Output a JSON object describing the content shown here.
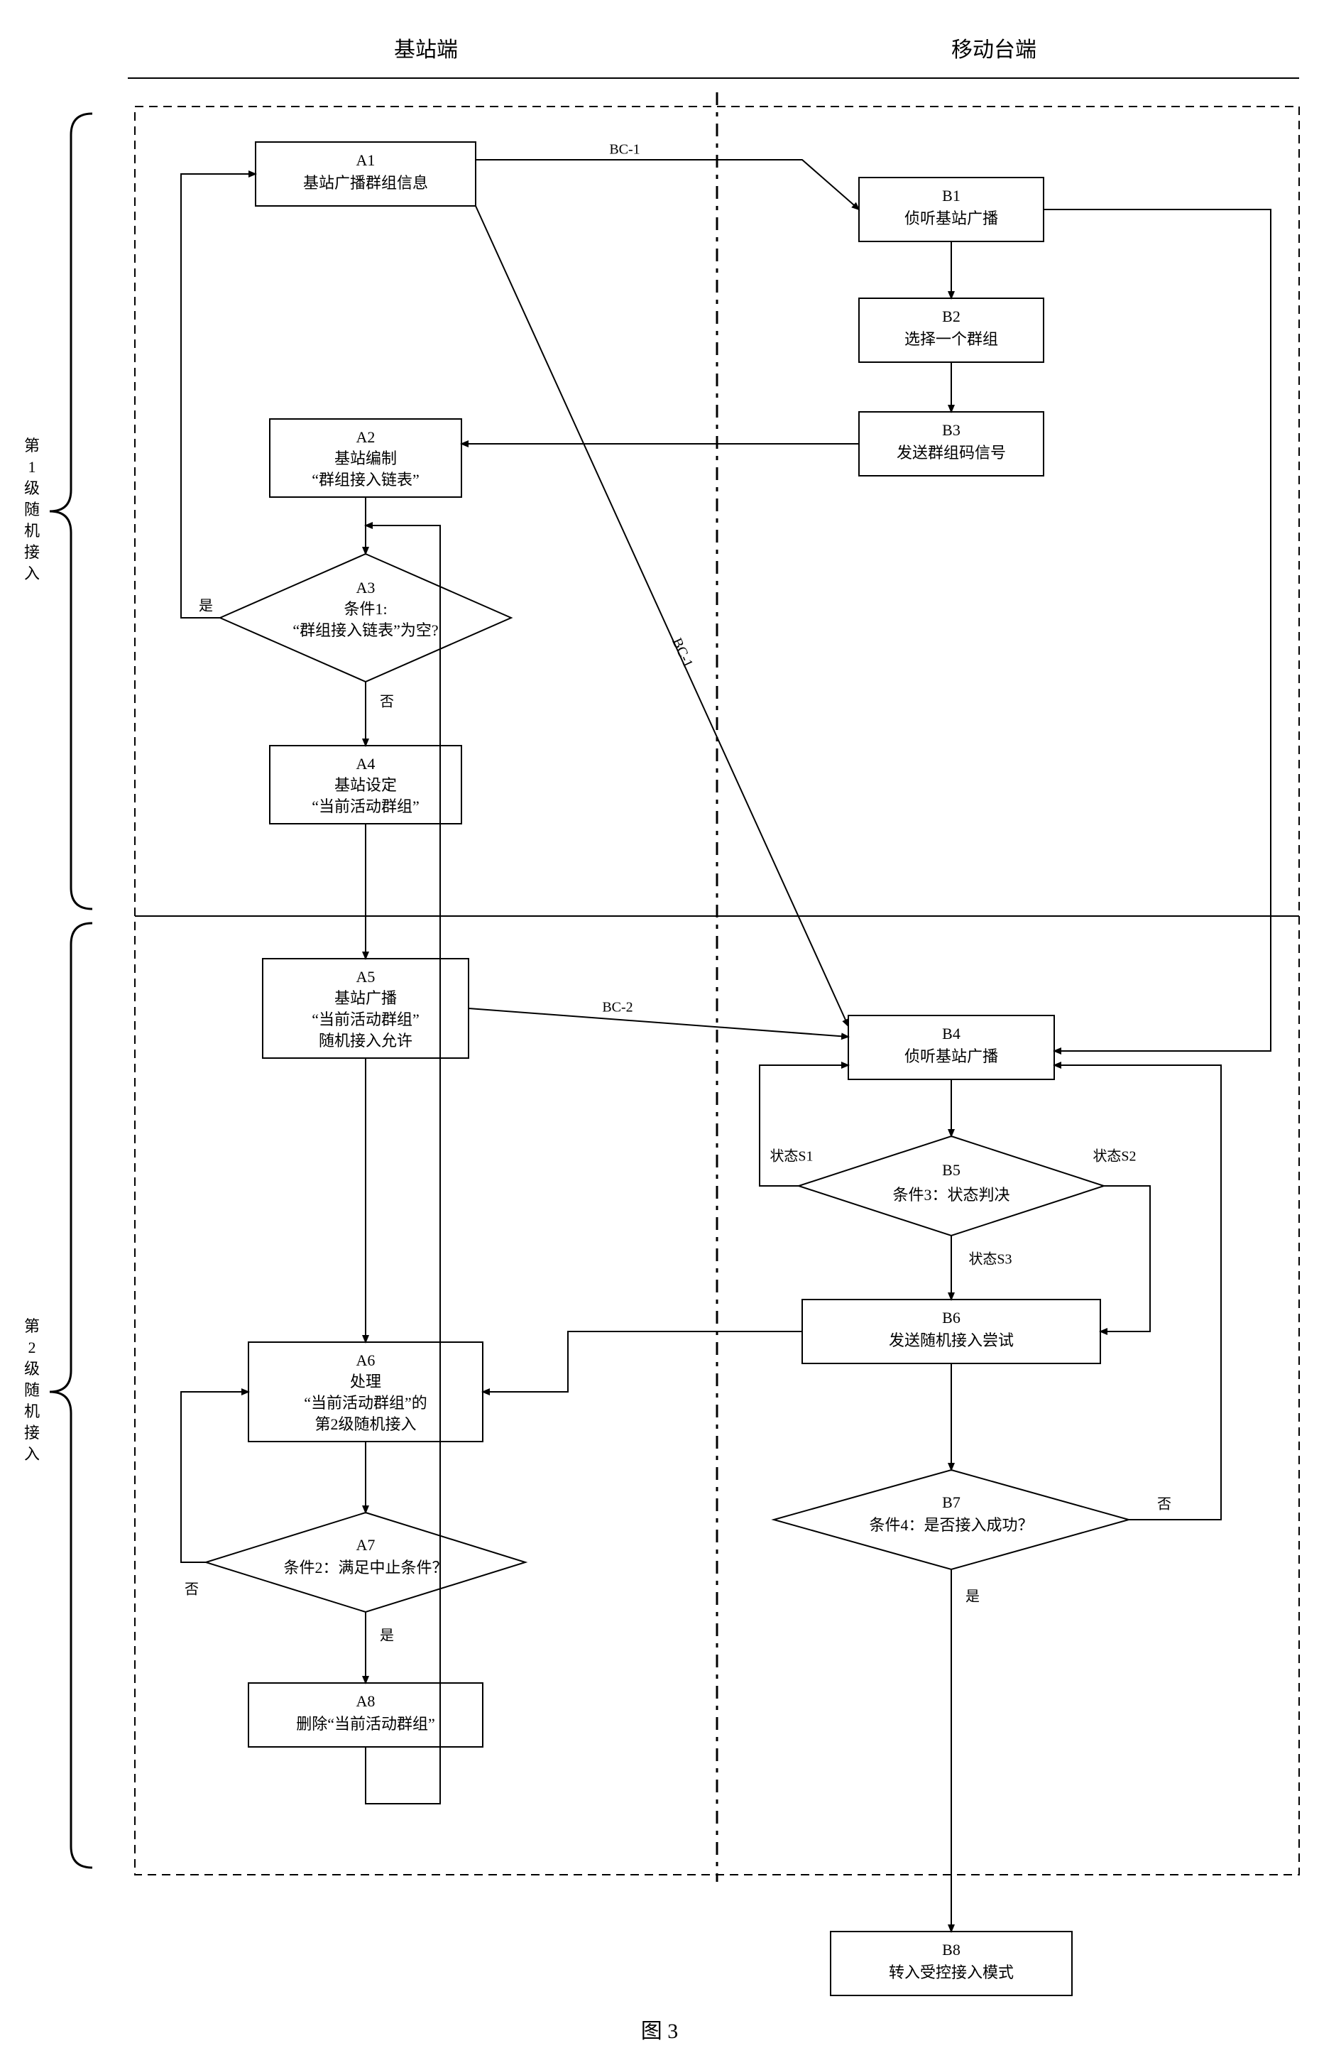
{
  "figure_label": "图 3",
  "columns": {
    "left": "基站端",
    "right": "移动台端"
  },
  "stages": {
    "s1": "第1级随机接入",
    "s2": "第2级随机接入"
  },
  "A1": {
    "id": "A1",
    "text": "基站广播群组信息"
  },
  "A2": {
    "id": "A2",
    "l1": "基站编制",
    "l2": "“群组接入链表”"
  },
  "A3": {
    "id": "A3",
    "l1": "条件1:",
    "l2": "“群组接入链表”为空?"
  },
  "A4": {
    "id": "A4",
    "l1": "基站设定",
    "l2": "“当前活动群组”"
  },
  "A5": {
    "id": "A5",
    "l1": "基站广播",
    "l2": "“当前活动群组”",
    "l3": "随机接入允许"
  },
  "A6": {
    "id": "A6",
    "l1": "处理",
    "l2": "“当前活动群组”的",
    "l3": "第2级随机接入"
  },
  "A7": {
    "id": "A7",
    "text": "条件2：满足中止条件？"
  },
  "A8": {
    "id": "A8",
    "text": "删除“当前活动群组”"
  },
  "B1": {
    "id": "B1",
    "text": "侦听基站广播"
  },
  "B2": {
    "id": "B2",
    "text": "选择一个群组"
  },
  "B3": {
    "id": "B3",
    "text": "发送群组码信号"
  },
  "B4": {
    "id": "B4",
    "text": "侦听基站广播"
  },
  "B5": {
    "id": "B5",
    "text": "条件3：状态判决"
  },
  "B6": {
    "id": "B6",
    "text": "发送随机接入尝试"
  },
  "B7": {
    "id": "B7",
    "text": "条件4：是否接入成功？"
  },
  "B8": {
    "id": "B8",
    "text": "转入受控接入模式"
  },
  "labels": {
    "bc1": "BC-1",
    "bc2": "BC-2",
    "yes": "是",
    "no": "否",
    "s1": "状态S1",
    "s2": "状态S2",
    "s3": "状态S3"
  }
}
